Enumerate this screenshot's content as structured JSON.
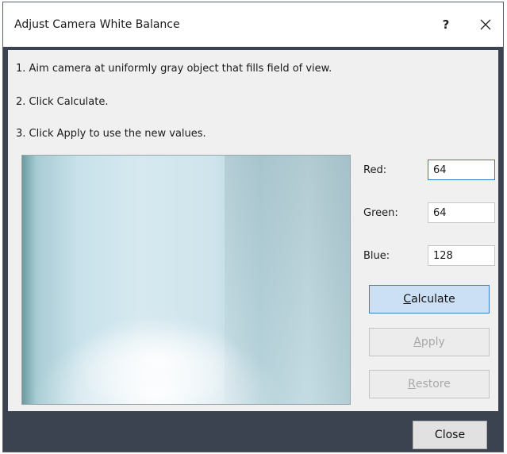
{
  "window": {
    "title": "Adjust Camera White Balance",
    "help_label": "?",
    "close_icon": "close-icon"
  },
  "instructions": [
    "1. Aim camera at uniformly gray object that fills field of view.",
    "2. Click Calculate.",
    "3. Click Apply to use the new values."
  ],
  "fields": {
    "red": {
      "label": "Red:",
      "value": "64"
    },
    "green": {
      "label": "Green:",
      "value": "64"
    },
    "blue": {
      "label": "Blue:",
      "value": "128"
    }
  },
  "buttons": {
    "calculate": {
      "mnemonic": "C",
      "rest": "alculate"
    },
    "apply": {
      "mnemonic": "A",
      "rest": "pply"
    },
    "restore": {
      "mnemonic": "R",
      "rest": "estore"
    },
    "close": "Close"
  },
  "colors": {
    "accent": "#3f7fc8",
    "primary_button_bg": "#cce0f5",
    "disabled_text": "#a8a8a8",
    "frame": "#3b4350"
  }
}
